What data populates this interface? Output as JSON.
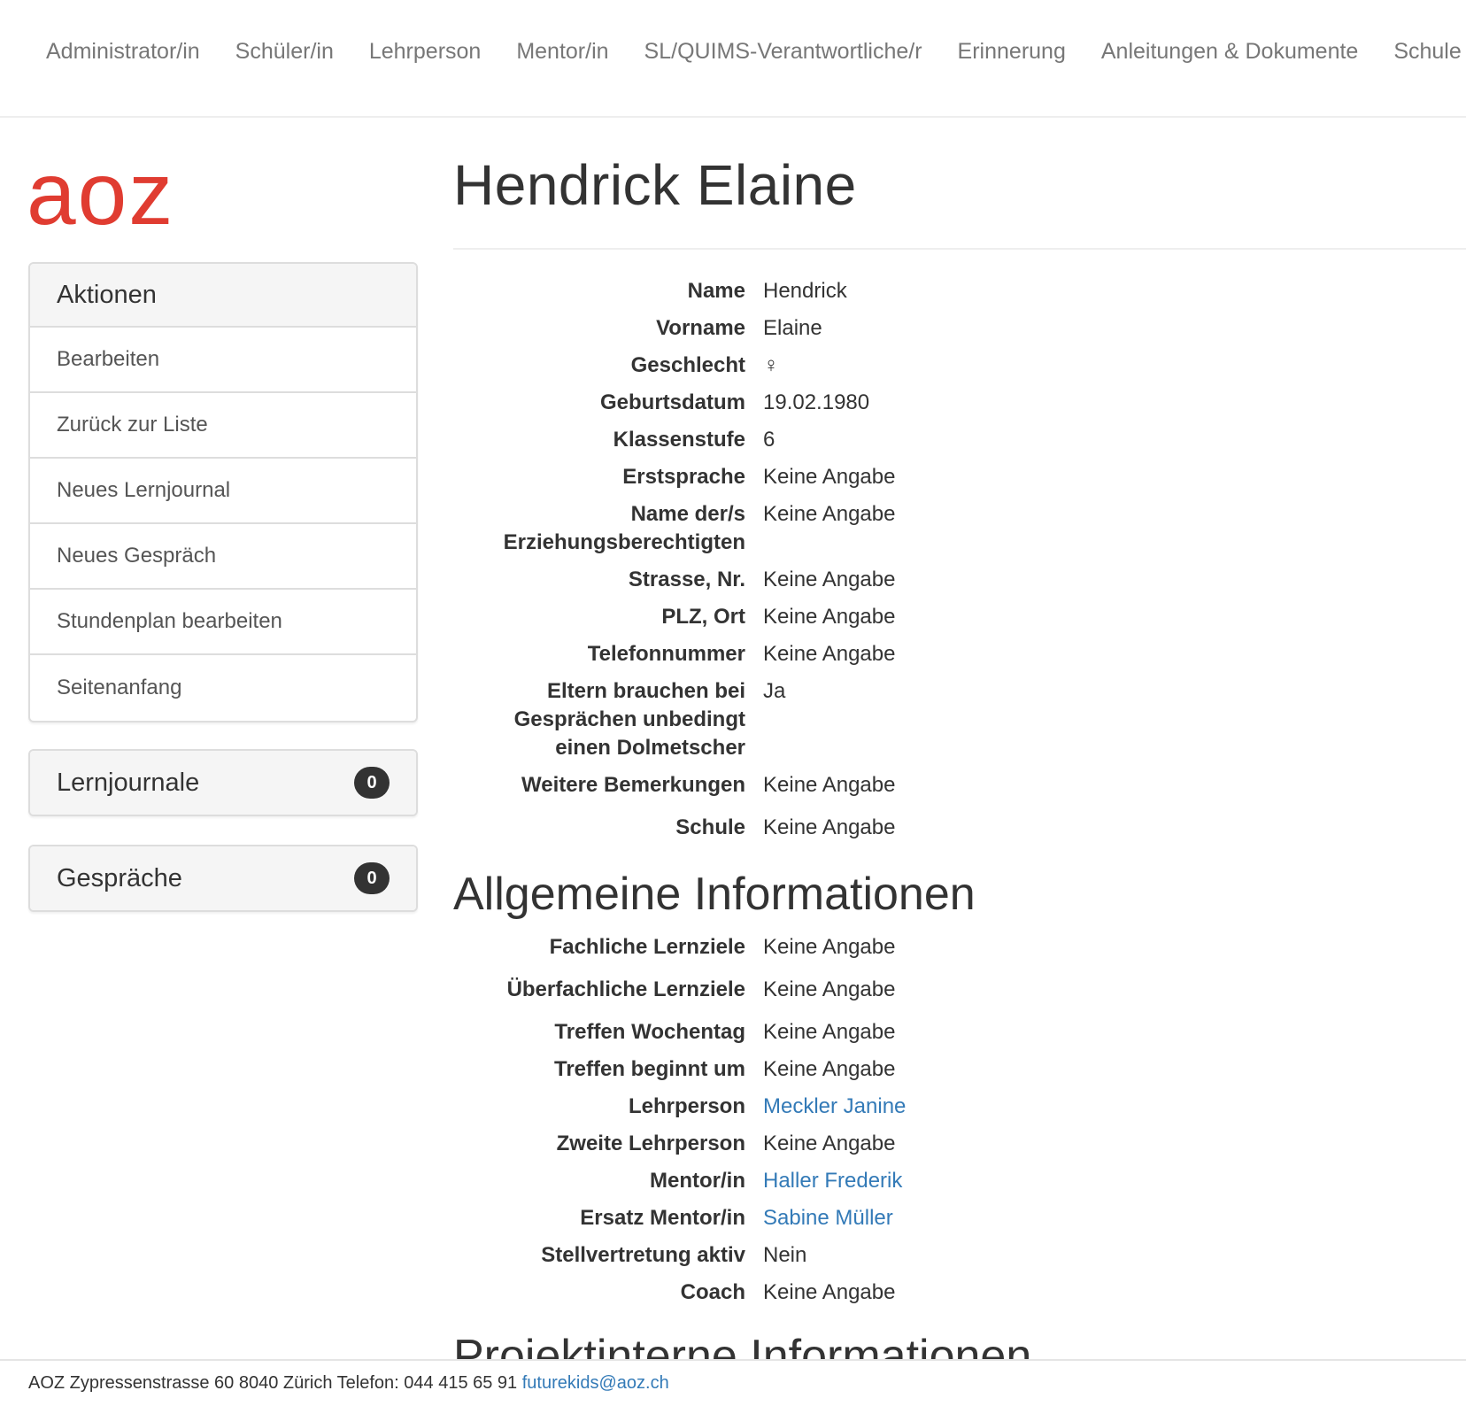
{
  "nav": {
    "items": [
      "Administrator/in",
      "Schüler/in",
      "Lehrperson",
      "Mentor/in",
      "SL/QUIMS-Verantwortliche/r",
      "Erinnerung",
      "Anleitungen & Dokumente",
      "Schule"
    ]
  },
  "logo": {
    "text": "aoz",
    "color": "#e03c31"
  },
  "sidebar": {
    "actions": {
      "title": "Aktionen",
      "items": [
        "Bearbeiten",
        "Zurück zur Liste",
        "Neues Lernjournal",
        "Neues Gespräch",
        "Stundenplan bearbeiten",
        "Seitenanfang"
      ]
    },
    "lernjournale": {
      "title": "Lernjournale",
      "count": "0"
    },
    "gespraeche": {
      "title": "Gespräche",
      "count": "0"
    }
  },
  "main": {
    "title": "Hendrick Elaine",
    "details": [
      {
        "label": "Name",
        "value": "Hendrick"
      },
      {
        "label": "Vorname",
        "value": "Elaine"
      },
      {
        "label": "Geschlecht",
        "value": "♀"
      },
      {
        "label": "Geburtsdatum",
        "value": "19.02.1980"
      },
      {
        "label": "Klassenstufe",
        "value": "6"
      },
      {
        "label": "Erstsprache",
        "value": "Keine Angabe"
      },
      {
        "label": "Name der/s Erziehungsberechtigten",
        "value": "Keine Angabe"
      },
      {
        "label": "Strasse, Nr.",
        "value": "Keine Angabe"
      },
      {
        "label": "PLZ, Ort",
        "value": "Keine Angabe"
      },
      {
        "label": "Telefonnummer",
        "value": "Keine Angabe"
      },
      {
        "label": "Eltern brauchen bei Gesprächen unbedingt einen Dolmetscher",
        "value": "Ja"
      },
      {
        "label": "Weitere Bemerkungen",
        "value": "Keine Angabe"
      },
      {
        "label": "Schule",
        "value": "Keine Angabe"
      }
    ],
    "general_title": "Allgemeine Informationen",
    "general": [
      {
        "label": "Fachliche Lernziele",
        "value": "Keine Angabe"
      },
      {
        "label": "Überfachliche Lernziele",
        "value": "Keine Angabe"
      },
      {
        "label": "Treffen Wochentag",
        "value": "Keine Angabe"
      },
      {
        "label": "Treffen beginnt um",
        "value": "Keine Angabe"
      },
      {
        "label": "Lehrperson",
        "value": "Meckler Janine"
      },
      {
        "label": "Zweite Lehrperson",
        "value": "Keine Angabe"
      },
      {
        "label": "Mentor/in",
        "value": "Haller Frederik"
      },
      {
        "label": "Ersatz Mentor/in",
        "value": "Sabine Müller"
      },
      {
        "label": "Stellvertretung aktiv",
        "value": "Nein"
      },
      {
        "label": "Coach",
        "value": "Keine Angabe"
      }
    ],
    "projekt_title": "Projektinterne Informationen"
  },
  "footer": {
    "address": "AOZ Zypressenstrasse 60 8040 Zürich Telefon: 044 415 65 91",
    "email": "futurekids@aoz.ch"
  },
  "colors": {
    "link": "#337ab7",
    "brand": "#e03c31",
    "muted": "#777777"
  }
}
